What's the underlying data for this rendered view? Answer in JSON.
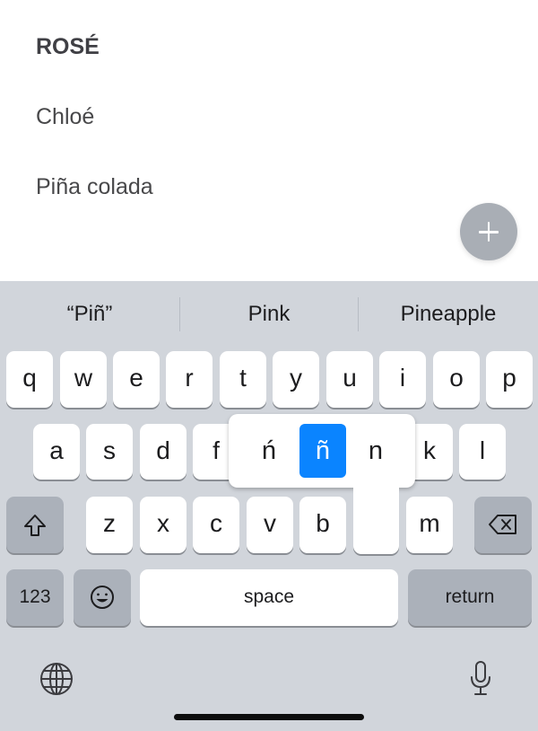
{
  "list": {
    "items": [
      "ROSÉ",
      "Chloé",
      "Piña colada"
    ]
  },
  "suggestions": [
    "“Piñ”",
    "Pink",
    "Pineapple"
  ],
  "keyboard": {
    "row1": [
      "q",
      "w",
      "e",
      "r",
      "t",
      "y",
      "u",
      "i",
      "o",
      "p"
    ],
    "row2": [
      "a",
      "s",
      "d",
      "f",
      "k",
      "l"
    ],
    "row3": [
      "z",
      "x",
      "c",
      "v",
      "b",
      "m"
    ],
    "numbers_label": "123",
    "space_label": "space",
    "return_label": "return",
    "accent_popup": [
      "ń",
      "ñ",
      "n"
    ],
    "selected_accent": "ñ"
  },
  "icons": {
    "add": "plus-icon",
    "shift": "shift-icon",
    "delete": "backspace-icon",
    "emoji": "emoji-icon",
    "globe": "globe-icon",
    "microphone": "microphone-icon"
  },
  "colors": {
    "keyboard_background": "#d1d5db",
    "selected_accent": "#0a84ff",
    "floating_button": "#a9aeb5"
  }
}
